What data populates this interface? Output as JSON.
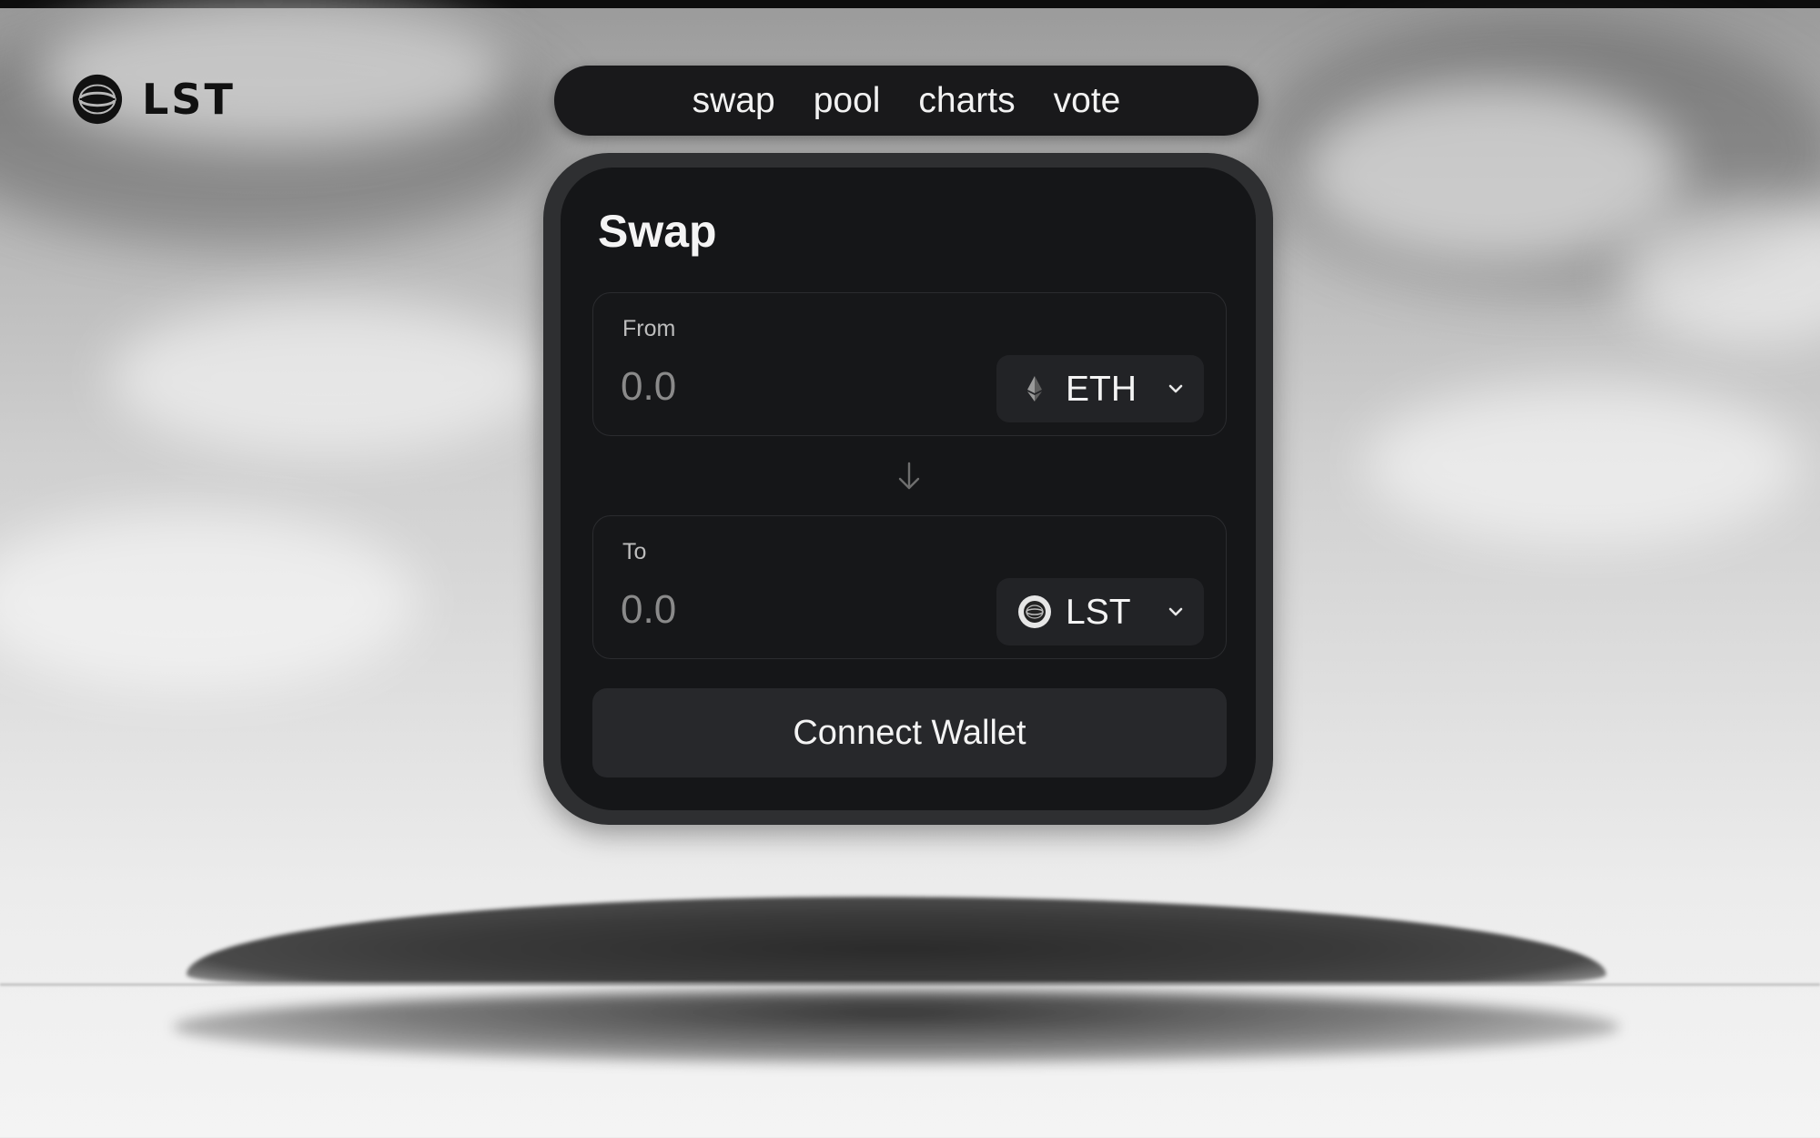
{
  "brand": {
    "name": "LST",
    "logo_icon": "lst-globe-icon"
  },
  "nav": {
    "items": [
      {
        "label": "swap"
      },
      {
        "label": "pool"
      },
      {
        "label": "charts"
      },
      {
        "label": "vote"
      }
    ]
  },
  "swap": {
    "title": "Swap",
    "from": {
      "label": "From",
      "placeholder": "0.0",
      "token": "ETH",
      "token_icon": "eth-icon"
    },
    "to": {
      "label": "To",
      "placeholder": "0.0",
      "token": "LST",
      "token_icon": "lst-icon"
    },
    "direction_icon": "arrow-down-icon",
    "connect_label": "Connect Wallet"
  },
  "colors": {
    "card": "#151618",
    "card_border": "#2e2f31",
    "nav": "#19191b",
    "button": "#27282b",
    "text": "#f4f4f4",
    "muted": "#8a8a8a"
  }
}
